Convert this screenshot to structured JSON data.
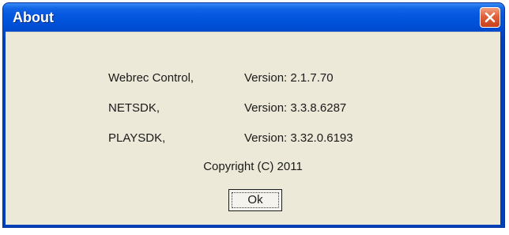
{
  "window": {
    "title": "About"
  },
  "info": {
    "rows": [
      {
        "name": "Webrec Control,",
        "version": "Version: 2.1.7.70"
      },
      {
        "name": "NETSDK,",
        "version": "Version: 3.3.8.6287"
      },
      {
        "name": "PLAYSDK,",
        "version": "Version: 3.32.0.6193"
      }
    ],
    "copyright": "Copyright (C) 2011"
  },
  "buttons": {
    "ok_label": "Ok"
  },
  "icons": {
    "close": "close-icon"
  },
  "colors": {
    "titlebar": "#0050d8",
    "close_button": "#e0603a",
    "client_background": "#ece9d8"
  }
}
